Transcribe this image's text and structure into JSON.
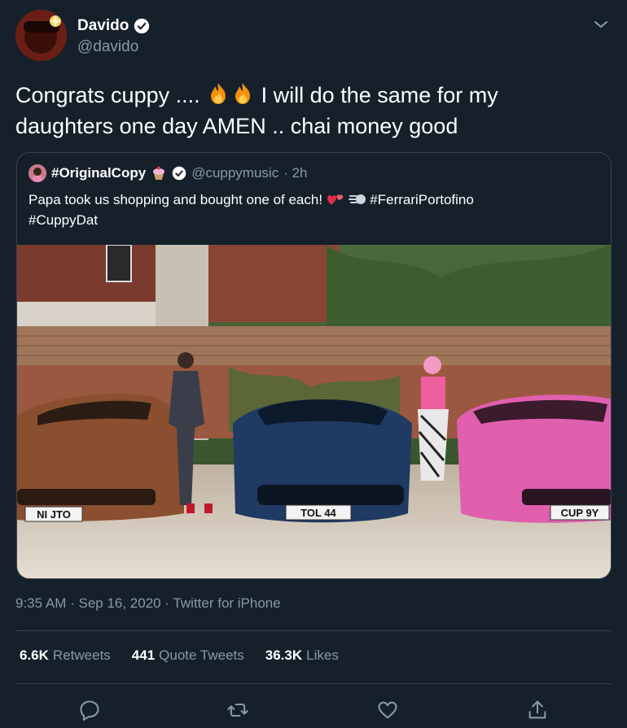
{
  "author": {
    "display_name": "Davido",
    "handle": "@davido"
  },
  "tweet": {
    "text_part1": "Congrats cuppy ....",
    "text_part2": "I will do the same for my daughters one day AMEN .. chai money good",
    "emojis": [
      "fire-icon",
      "fire-icon"
    ]
  },
  "quoted": {
    "display_name": "#OriginalCopy",
    "handle": "@cuppymusic",
    "time": "· 2h",
    "text_part1": "Papa took us shopping and bought one of each!",
    "hashtag1": "#FerrariPortofino",
    "hashtag2": "#CuppyDat",
    "plates": [
      "NI JTO",
      "TOL 44",
      "CUP 9Y"
    ],
    "car_colors": [
      "#8a4f2e",
      "#1f3a63",
      "#e05fae"
    ]
  },
  "meta": {
    "timestamp": "9:35 AM · Sep 16, 2020",
    "separator": " · ",
    "source": "Twitter for iPhone"
  },
  "stats": {
    "retweets_count": "6.6K",
    "retweets_label": "Retweets",
    "quotes_count": "441",
    "quotes_label": "Quote Tweets",
    "likes_count": "36.3K",
    "likes_label": "Likes"
  },
  "colors": {
    "background": "#15202b",
    "secondary_text": "#8899a6",
    "border": "#38444d",
    "verified": "#ffffff"
  }
}
